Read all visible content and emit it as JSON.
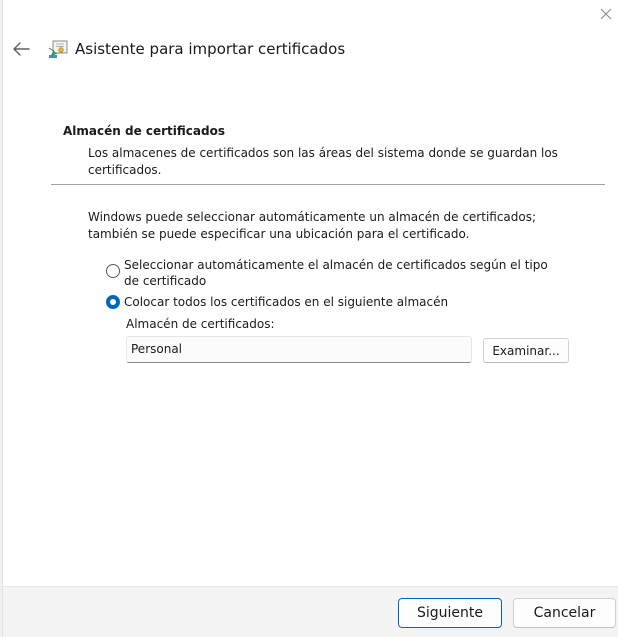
{
  "window": {
    "title": "Asistente para importar certificados",
    "close_icon": "close-icon",
    "back_icon": "back-arrow-icon",
    "wizard_icon": "certificate-wizard-icon"
  },
  "section": {
    "title": "Almacén de certificados",
    "description": "Los almacenes de certificados son las áreas del sistema donde se guardan los certificados."
  },
  "intro": "Windows puede seleccionar automáticamente un almacén de certificados; también se puede especificar una ubicación para el certificado.",
  "options": [
    {
      "label": "Seleccionar automáticamente el almacén de certificados según el tipo de certificado",
      "selected": false
    },
    {
      "label": "Colocar todos los certificados en el siguiente almacén",
      "selected": true
    }
  ],
  "store": {
    "label": "Almacén de certificados:",
    "value": "Personal",
    "browse_label": "Examinar..."
  },
  "footer": {
    "next_label": "Siguiente",
    "cancel_label": "Cancelar"
  },
  "colors": {
    "accent": "#0067c0",
    "footer_bg": "#f3f3f3"
  }
}
